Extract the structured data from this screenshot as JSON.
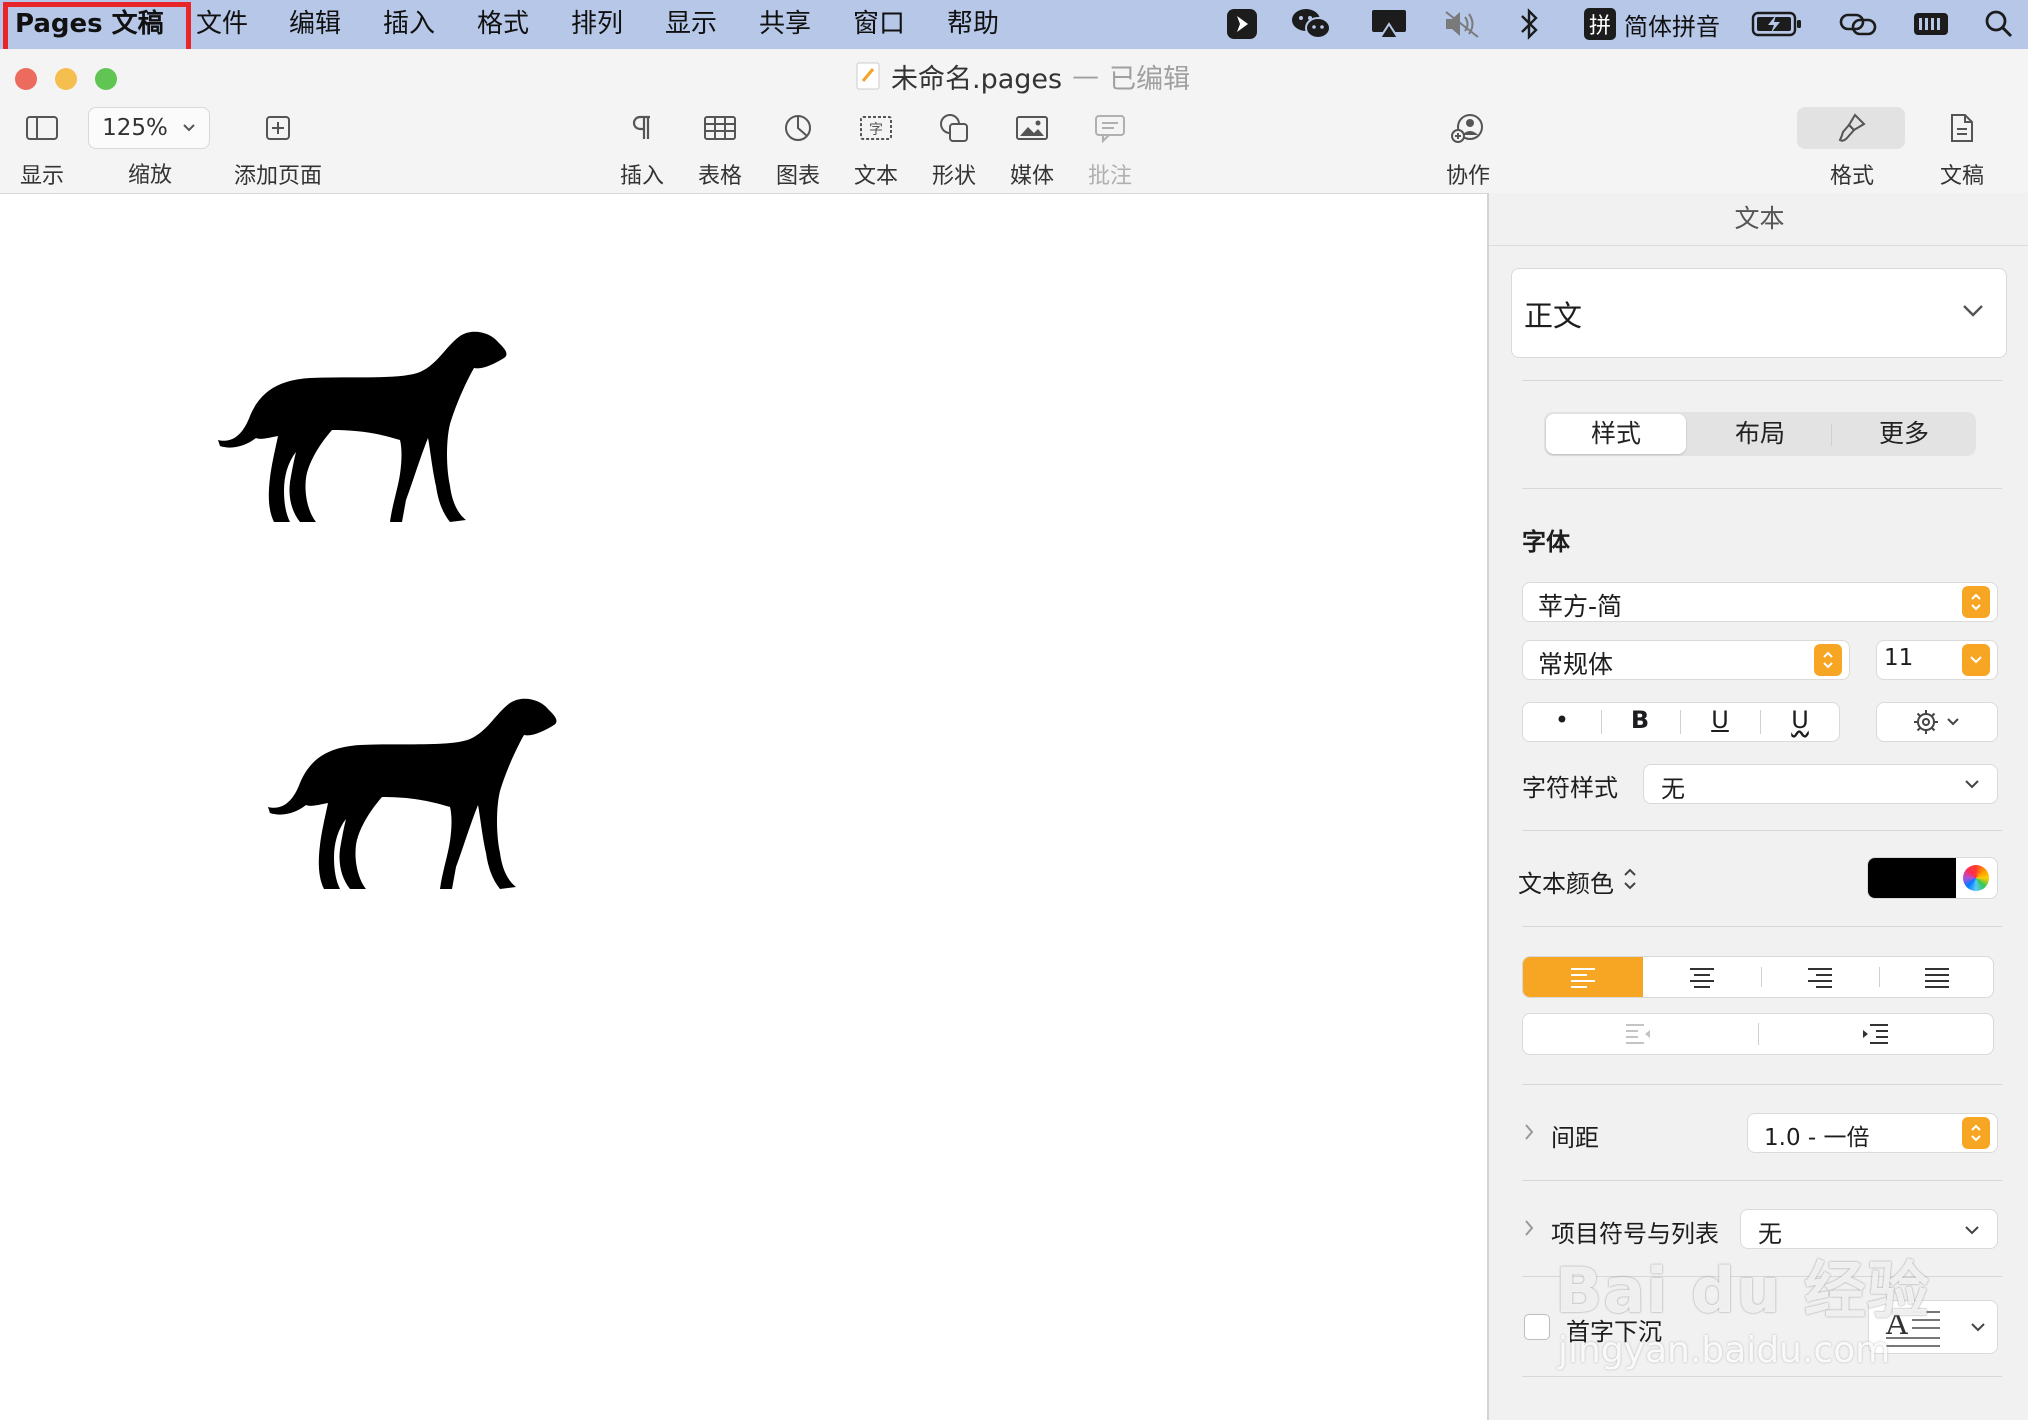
{
  "menubar": {
    "app_name": "Pages 文稿",
    "items": [
      "文件",
      "编辑",
      "插入",
      "格式",
      "排列",
      "显示",
      "共享",
      "窗口",
      "帮助"
    ],
    "input_method": "简体拼音",
    "input_method_badge": "拼",
    "tray_icons": [
      "pen-app-icon",
      "wechat-icon",
      "airplay-display-icon",
      "muted-speaker-icon",
      "bluetooth-icon",
      "input-method-icon",
      "battery-charging-icon",
      "link-icon",
      "keyboard-icon",
      "search-icon"
    ],
    "highlight_color": "#e8262a"
  },
  "window": {
    "title": "未命名.pages",
    "separator": "—",
    "status": "已编辑"
  },
  "toolbar": {
    "view_label": "显示",
    "zoom_value": "125%",
    "zoom_label": "缩放",
    "add_page_label": "添加页面",
    "insert_label": "插入",
    "table_label": "表格",
    "chart_label": "图表",
    "text_label": "文本",
    "shape_label": "形状",
    "media_label": "媒体",
    "comment_label": "批注",
    "collaborate_label": "协作",
    "format_label": "格式",
    "document_label": "文稿"
  },
  "canvas": {
    "images": [
      "dog-silhouette-icon",
      "dog-silhouette-icon"
    ]
  },
  "sidebar": {
    "title": "文本",
    "paragraph_style": "正文",
    "tabs": [
      "样式",
      "布局",
      "更多"
    ],
    "active_tab": "样式",
    "font_section": "字体",
    "font_family": "苹方-简",
    "font_weight": "常规体",
    "font_size": "11",
    "style_buttons": [
      "•",
      "B",
      "U",
      "U"
    ],
    "char_style_label": "字符样式",
    "char_style_value": "无",
    "text_color_label": "文本颜色",
    "text_color_value": "#000000",
    "alignment_active": "left",
    "accent_color": "#f6a623",
    "spacing_label": "间距",
    "spacing_value": "1.0 - 一倍",
    "bullets_label": "项目符号与列表",
    "bullets_value": "无",
    "dropcap_label": "首字下沉",
    "dropcap_checked": false
  },
  "watermark": {
    "line1": "Bai du 经验",
    "line2": "jingyan.baidu.com"
  }
}
